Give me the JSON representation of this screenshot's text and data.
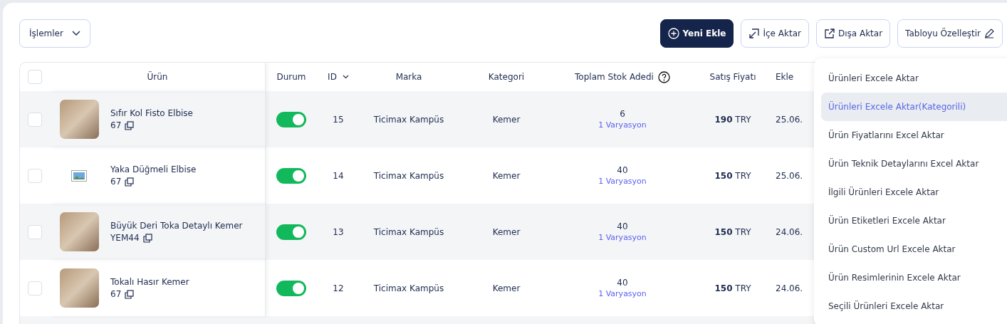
{
  "toolbar": {
    "actions_dropdown": "İşlemler",
    "buttons": [
      {
        "label": "Yeni Ekle",
        "kind": "primary"
      },
      {
        "label": "İçe Aktar",
        "kind": "import"
      },
      {
        "label": "Dışa Aktar",
        "kind": "export"
      },
      {
        "label": "Tabloyu Özelleştir",
        "kind": "customize"
      }
    ]
  },
  "table": {
    "columns": [
      "Ürün",
      "Durum",
      "ID",
      "Marka",
      "Kategori",
      "Toplam Stok Adedi",
      "Satış Fiyatı",
      "Ekle"
    ],
    "header_checked": false,
    "rows": [
      {
        "checked": false,
        "kind": "photo",
        "name": "Sıfır Kol Fisto Elbise",
        "code": "67",
        "on": true,
        "id": "15",
        "brand": "Ticimax Kampüs",
        "category": "Kemer",
        "stock": "6",
        "variants": "1 Varyasyon",
        "price": "**190** TRY",
        "date": "25.06."
      },
      {
        "checked": false,
        "kind": "placeholder",
        "name": "Yaka Düğmeli Elbise",
        "code": "67",
        "on": true,
        "id": "14",
        "brand": "Ticimax Kampüs",
        "category": "Kemer",
        "stock": "40",
        "variants": "1 Varyasyon",
        "price": "**150** TRY",
        "date": "25.06."
      },
      {
        "checked": false,
        "kind": "photo",
        "name": "Büyük Deri Toka Detaylı Kemer",
        "code": "YEM44",
        "on": true,
        "id": "13",
        "brand": "Ticimax Kampüs",
        "category": "Kemer",
        "stock": "40",
        "variants": "1 Varyasyon",
        "price": "**150** TRY",
        "date": "24.06."
      },
      {
        "checked": false,
        "kind": "photo",
        "name": "Tokalı Hasır Kemer",
        "code": "67",
        "on": true,
        "id": "12",
        "brand": "Ticimax Kampüs",
        "category": "Kemer",
        "stock": "40",
        "variants": "1 Varyasyon",
        "price": "**150** TRY",
        "date": "24.06."
      }
    ]
  },
  "export_menu": {
    "items": [
      {
        "label": "Ürünleri Excele Aktar",
        "selected": false
      },
      {
        "label": "Ürünleri Excele Aktar(Kategorili)",
        "selected": true
      },
      {
        "label": "Ürün Fiyatlarını Excel Aktar",
        "selected": false
      },
      {
        "label": "Ürün Teknik Detaylarını Excel Aktar",
        "selected": false
      },
      {
        "label": "İlgili Ürünleri Excele Aktar",
        "selected": false
      },
      {
        "label": "Ürün Etiketleri Excele Aktar",
        "selected": false
      },
      {
        "label": "Ürün Custom Url Excele Aktar",
        "selected": false
      },
      {
        "label": "Ürün Resimlerinin Excele Aktar",
        "selected": false
      },
      {
        "label": "Seçili Ürünleri Excele Aktar",
        "selected": false
      }
    ]
  }
}
